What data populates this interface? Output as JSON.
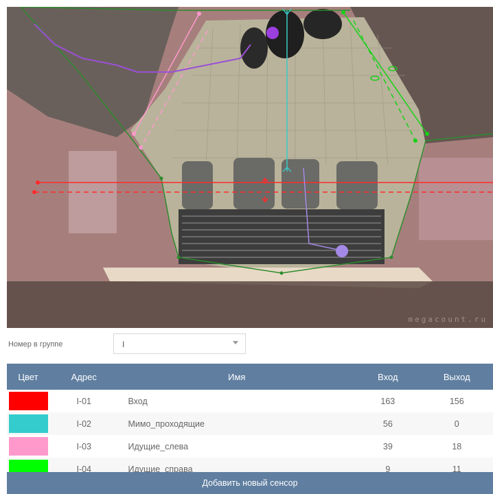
{
  "camera": {
    "watermark": "megacount.ru"
  },
  "group": {
    "label": "Номер в группе",
    "selected": "I"
  },
  "table": {
    "headers": [
      "Цвет",
      "Адрес",
      "Имя",
      "Вход",
      "Выход"
    ],
    "rows": [
      {
        "color": "#ff0000",
        "address": "I-01",
        "name": "Вход",
        "in": "163",
        "out": "156"
      },
      {
        "color": "#34cccc",
        "address": "I-02",
        "name": "Мимо_проходящие",
        "in": "56",
        "out": "0"
      },
      {
        "color": "#ff99cc",
        "address": "I-03",
        "name": "Идущие_слева",
        "in": "39",
        "out": "18"
      },
      {
        "color": "#00ff00",
        "address": "I-04",
        "name": "Идущие_справа",
        "in": "9",
        "out": "11"
      }
    ]
  },
  "add_button": "Добавить новый сенсор"
}
